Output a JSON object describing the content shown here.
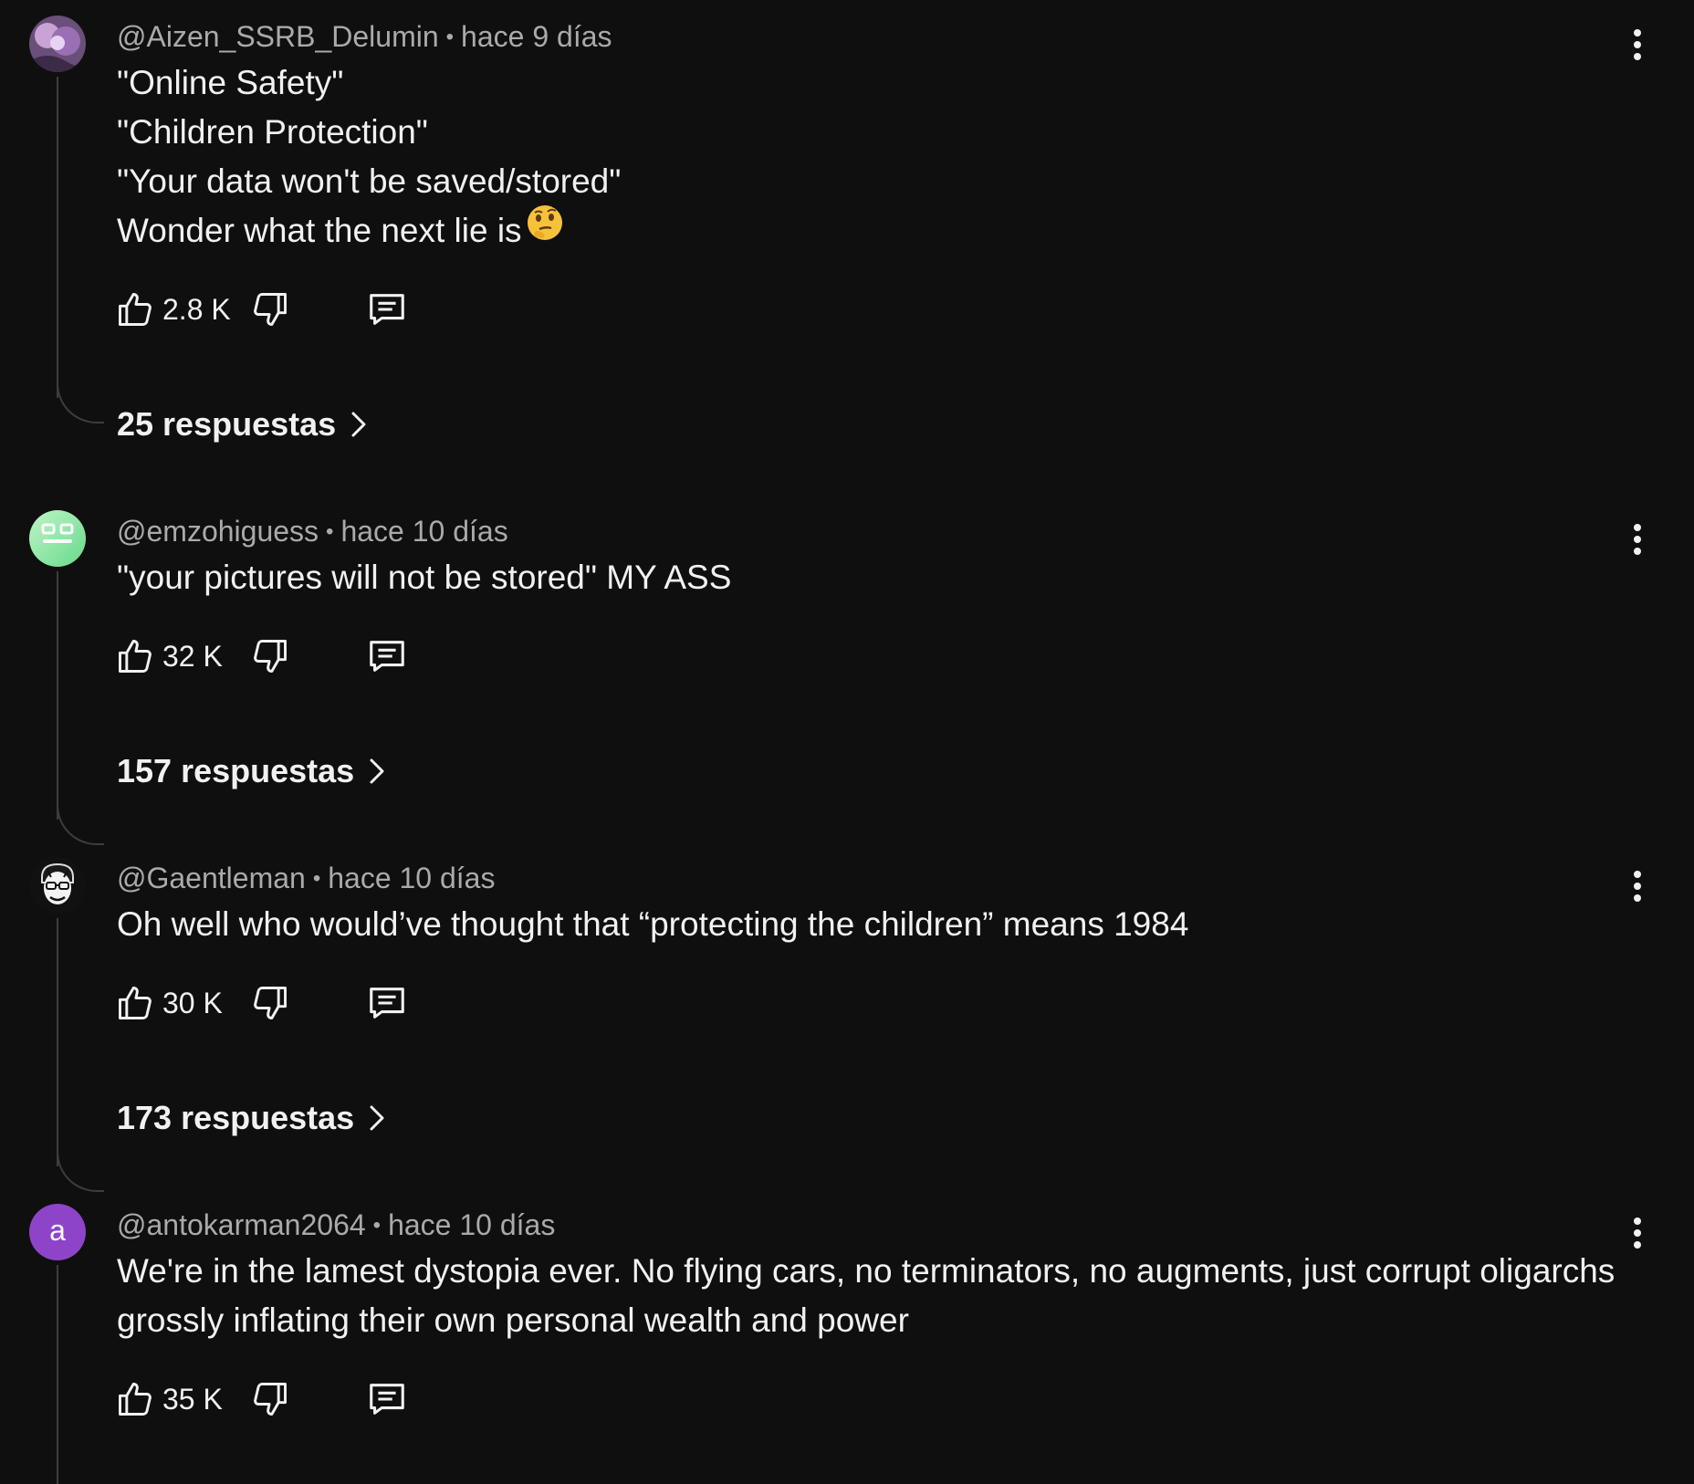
{
  "comments": [
    {
      "author": "@Aizen_SSRB_Delumin",
      "time": "hace 9 días",
      "text": "\"Online Safety\"\n\"Children Protection\"\n\"Your data won't be saved/stored\"\nWonder what the next lie is",
      "emoji": "thinking-face",
      "likes": "2.8 K",
      "replies": "25 respuestas",
      "avatar": "anime-character-avatar"
    },
    {
      "author": "@emzohiguess",
      "time": "hace 10 días",
      "text": "\"your pictures will not be stored\" MY ASS",
      "likes": "32 K",
      "replies": "157 respuestas",
      "avatar": "green-robot-avatar"
    },
    {
      "author": "@Gaentleman",
      "time": "hace 10 días",
      "text": "Oh well who would’ve thought that “protecting the children” means 1984",
      "likes": "30 K",
      "replies": "173 respuestas",
      "avatar": "cartoon-face-avatar"
    },
    {
      "author": "@antokarman2064",
      "time": "hace 10 días",
      "text": "We're in the lamest dystopia ever. No flying cars, no terminators, no augments, just corrupt oligarchs grossly inflating their own personal wealth and power",
      "likes": "35 K",
      "avatar_letter": "a",
      "avatar_color": "#8e44c9"
    }
  ],
  "colors": {
    "background": "#0f0f0f",
    "text_primary": "#f1f1f1",
    "text_secondary": "#aaaaaa",
    "thread_line": "#3d3d3d"
  }
}
